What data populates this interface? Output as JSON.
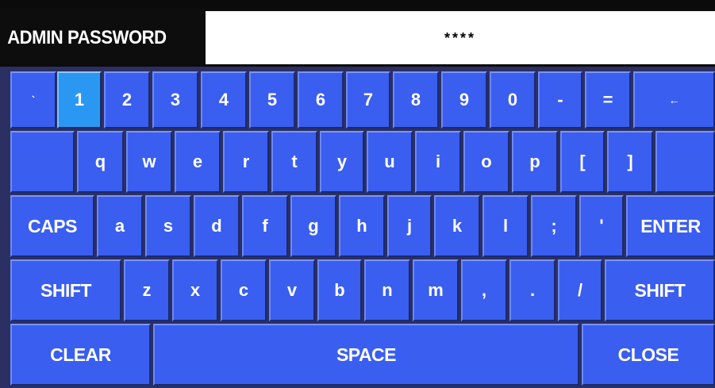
{
  "header": {
    "title": "ADMIN PASSWORD",
    "password_value": "****"
  },
  "colors": {
    "key_bg": "#3a5ef0",
    "key_active_bg": "#2a98f2",
    "keyboard_bg": "#2b2f62",
    "header_bg": "#0d0d0d",
    "text": "#ffffff"
  },
  "keyboard": {
    "row1": [
      "`",
      "1",
      "2",
      "3",
      "4",
      "5",
      "6",
      "7",
      "8",
      "9",
      "0",
      "-",
      "=",
      "←"
    ],
    "row2": [
      "",
      "q",
      "w",
      "e",
      "r",
      "t",
      "y",
      "u",
      "i",
      "o",
      "p",
      "[",
      "]",
      ""
    ],
    "row3": [
      "CAPS",
      "a",
      "s",
      "d",
      "f",
      "g",
      "h",
      "j",
      "k",
      "l",
      ";",
      "'",
      "ENTER"
    ],
    "row4": [
      "SHIFT",
      "z",
      "x",
      "c",
      "v",
      "b",
      "n",
      "m",
      ",",
      ".",
      "/",
      "SHIFT"
    ],
    "row5": [
      "CLEAR",
      "SPACE",
      "CLOSE"
    ],
    "active_key": "1"
  }
}
